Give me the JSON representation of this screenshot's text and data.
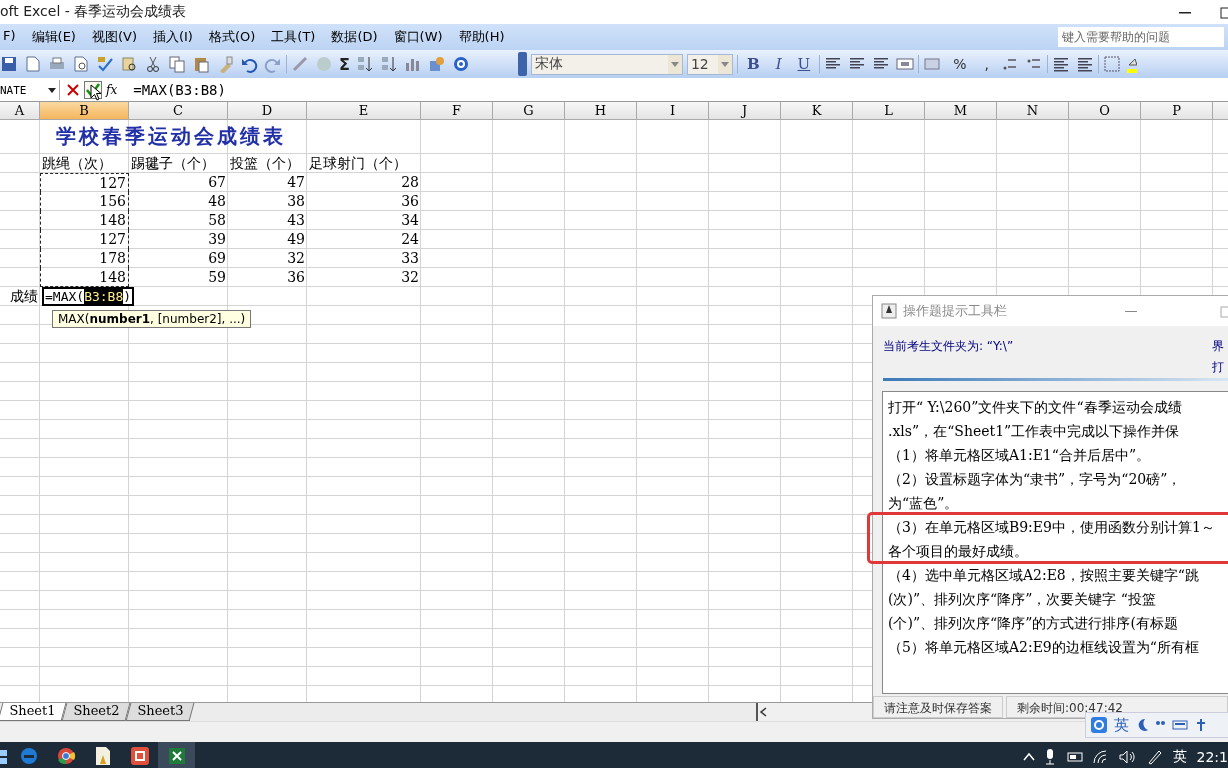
{
  "window": {
    "title": "oft Excel - 春季运动会成绩表"
  },
  "menu": [
    {
      "label": "F)"
    },
    {
      "label": "编辑(E)"
    },
    {
      "label": "视图(V)"
    },
    {
      "label": "插入(I)"
    },
    {
      "label": "格式(O)"
    },
    {
      "label": "工具(T)"
    },
    {
      "label": "数据(D)"
    },
    {
      "label": "窗口(W)"
    },
    {
      "label": "帮助(H)"
    }
  ],
  "help_search": {
    "placeholder": "键入需要帮助的问题"
  },
  "toolbar": {
    "sum": "Σ",
    "font": "宋体",
    "size": "12",
    "styles": [
      "B",
      "I",
      "U"
    ],
    "number_formats": [
      "%",
      ","
    ]
  },
  "formula_bar": {
    "name_box": "NATE",
    "fx": "fx",
    "formula": "=MAX(B3:B8)"
  },
  "columns": [
    {
      "label": "A",
      "selected": false
    },
    {
      "label": "B",
      "selected": true
    },
    {
      "label": "C",
      "selected": false
    },
    {
      "label": "D",
      "selected": false
    },
    {
      "label": "E",
      "selected": false
    },
    {
      "label": "F",
      "selected": false
    },
    {
      "label": "G",
      "selected": false
    },
    {
      "label": "H",
      "selected": false
    },
    {
      "label": "I",
      "selected": false
    },
    {
      "label": "J",
      "selected": false
    },
    {
      "label": "K",
      "selected": false
    },
    {
      "label": "L",
      "selected": false
    },
    {
      "label": "M",
      "selected": false
    },
    {
      "label": "N",
      "selected": false
    },
    {
      "label": "O",
      "selected": false
    },
    {
      "label": "P",
      "selected": false
    }
  ],
  "sheet": {
    "title": "学校春季运动会成绩表",
    "headers": [
      "跳绳（次）",
      "踢毽子（个）",
      "投篮（个）",
      "足球射门（个）"
    ],
    "rows": [
      {
        "values": [
          "127",
          "67",
          "47",
          "28"
        ],
        "in_reference": true
      },
      {
        "values": [
          "156",
          "48",
          "38",
          "36"
        ],
        "in_reference": true
      },
      {
        "values": [
          "148",
          "58",
          "43",
          "34"
        ],
        "in_reference": true
      },
      {
        "values": [
          "127",
          "39",
          "49",
          "24"
        ],
        "in_reference": true
      },
      {
        "values": [
          "178",
          "69",
          "32",
          "33"
        ],
        "in_reference": true
      },
      {
        "values": [
          "148",
          "59",
          "36",
          "32"
        ],
        "in_reference": true
      }
    ],
    "total": {
      "label": "成绩",
      "prefix": "=MAX(",
      "reference": "B3:B8",
      "suffix": ")"
    },
    "tooltip": "MAX(**number1**, [number2], ...)"
  },
  "sheet_tabs": [
    {
      "label": "Sheet1",
      "selected": true
    },
    {
      "label": "Sheet2",
      "selected": false
    },
    {
      "label": "Sheet3",
      "selected": false
    }
  ],
  "hint_panel": {
    "title": "操作题提示工具栏",
    "folder": "当前考生文件夹为: “Y:\\”",
    "side_lines": [
      "界",
      "打"
    ],
    "items": [
      {
        "lines": [
          "打开“ Y:\\260”文件夹下的文件“春季运动会成绩",
          ".xls”，在“Sheet1”工作表中完成以下操作并保"
        ],
        "highlighted": false
      },
      {
        "lines": [
          "（1）将单元格区域A1:E1“合并后居中”。"
        ],
        "highlighted": false
      },
      {
        "lines": [
          "（2）设置标题字体为“隶书”，字号为“20磅”，",
          "为“蓝色”。"
        ],
        "highlighted": false
      },
      {
        "lines": [
          "（3）在单元格区域B9:E9中，使用函数分别计算1～",
          "各个项目的最好成绩。"
        ],
        "highlighted": true
      },
      {
        "lines": [
          "（4）选中单元格区域A2:E8，按照主要关键字“跳",
          "(次)”、排列次序“降序”，次要关键字 “投篮",
          "(个)”、排列次序“降序”的方式进行排序(有标题"
        ],
        "highlighted": false
      },
      {
        "lines": [
          "（5）将单元格区域A2:E9的边框线设置为“所有框"
        ],
        "highlighted": false
      }
    ],
    "status": [
      "请注意及时保存答案",
      "剩余时间:00:47:42"
    ]
  },
  "ime_bar": {
    "label": "英"
  },
  "taskbar": {
    "apps": [
      {
        "kind": "edge",
        "selected": false
      },
      {
        "kind": "chrome",
        "selected": false
      },
      {
        "kind": "reader",
        "selected": false
      },
      {
        "kind": "recorder",
        "selected": false
      },
      {
        "kind": "excel",
        "selected": true
      }
    ],
    "language": "英",
    "clock": "22:1"
  }
}
